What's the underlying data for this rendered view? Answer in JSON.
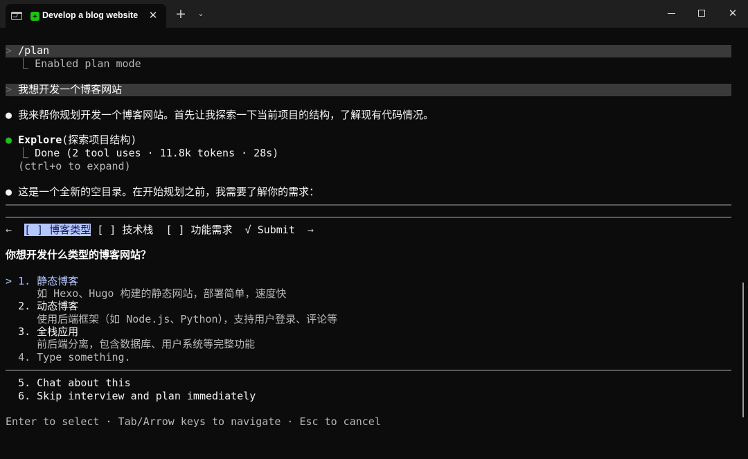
{
  "window": {
    "tab_title": "Develop a blog website",
    "close_glyph": "✕",
    "new_tab_glyph": "+",
    "dropdown_glyph": "⌄",
    "win_close_glyph": "✕"
  },
  "session": {
    "cmd1": {
      "glyph": ">",
      "text": "/plan"
    },
    "cmd1_result": {
      "branch": "⎿",
      "text": "Enabled plan mode"
    },
    "cmd2": {
      "glyph": ">",
      "text": "我想开发一个博客网站"
    },
    "msg1": {
      "dot": "●",
      "text": "我来帮你规划开发一个博客网站。首先让我探索一下当前项目的结构，了解现有代码情况。"
    },
    "tool": {
      "dot": "●",
      "name": "Explore",
      "arg": "(探索项目结构)"
    },
    "tool_result": {
      "branch": "⎿",
      "text": "Done (2 tool uses · 11.8k tokens · 28s)"
    },
    "tool_hint": "(ctrl+o to expand)",
    "msg2": {
      "dot": "●",
      "text": "这是一个全新的空目录。在开始规划之前，我需要了解你的需求："
    }
  },
  "wizard": {
    "left_arrow": "←",
    "steps": [
      {
        "label": "[ ] 博客类型"
      },
      {
        "label": "[ ] 技术栈"
      },
      {
        "label": "[ ] 功能需求"
      }
    ],
    "submit_check": "√",
    "submit": "Submit",
    "right_arrow": "→",
    "question": "你想开发什么类型的博客网站？",
    "cursor": ">",
    "options": [
      {
        "num": "1.",
        "label": "静态博客",
        "desc": "如 Hexo、Hugo 构建的静态网站，部署简单，速度快"
      },
      {
        "num": "2.",
        "label": "动态博客",
        "desc": "使用后端框架（如 Node.js、Python），支持用户登录、评论等"
      },
      {
        "num": "3.",
        "label": "全栈应用",
        "desc": "前后端分离，包含数据库、用户系统等完整功能"
      },
      {
        "num": "4.",
        "label": "Type something."
      }
    ],
    "extra": [
      {
        "num": "5.",
        "label": "Chat about this"
      },
      {
        "num": "6.",
        "label": "Skip interview and plan immediately"
      }
    ],
    "footer": "Enter to select · Tab/Arrow keys to navigate · Esc to cancel"
  }
}
